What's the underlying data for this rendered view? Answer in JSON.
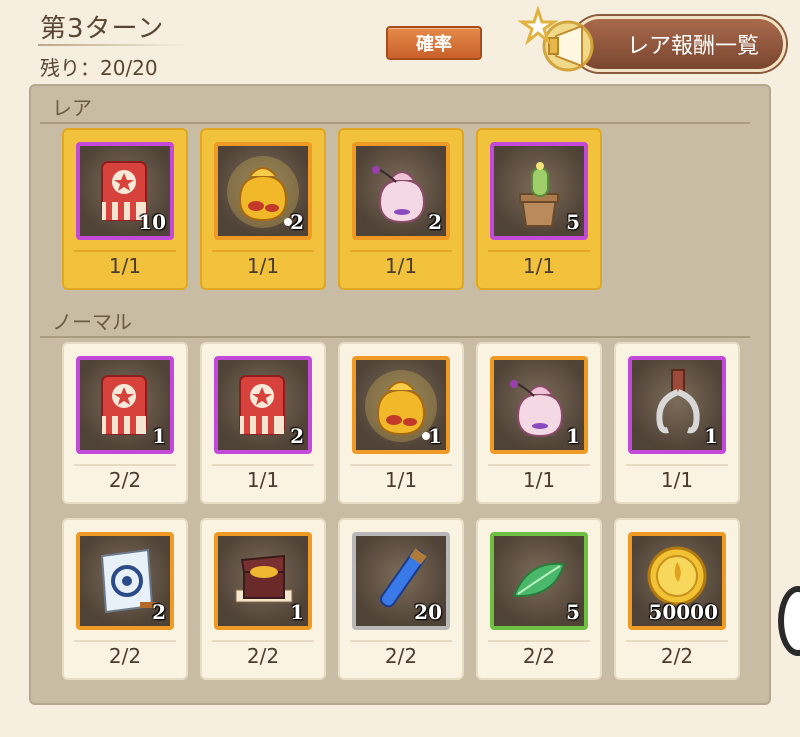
{
  "header": {
    "turn_title": "第3ターン",
    "remaining_label": "残り：20/20",
    "probability_button": "確率",
    "rare_rewards_button": "レア報酬一覧"
  },
  "sections": {
    "rare_label": "レア",
    "normal_label": "ノーマル"
  },
  "rare_items": [
    {
      "icon": "red-ticket-icon",
      "count": "10",
      "ratio": "1/1",
      "frame": "purple"
    },
    {
      "icon": "gold-pouch-icon",
      "count": "2",
      "ratio": "1/1",
      "frame": "orange"
    },
    {
      "icon": "pink-pouch-icon",
      "count": "2",
      "ratio": "1/1",
      "frame": "orange"
    },
    {
      "icon": "cactus-pot-icon",
      "count": "5",
      "ratio": "1/1",
      "frame": "purple"
    }
  ],
  "normal_row1": [
    {
      "icon": "red-ticket-icon",
      "count": "1",
      "ratio": "2/2",
      "frame": "purple"
    },
    {
      "icon": "red-ticket-icon",
      "count": "2",
      "ratio": "1/1",
      "frame": "purple"
    },
    {
      "icon": "gold-pouch-icon",
      "count": "1",
      "ratio": "1/1",
      "frame": "orange"
    },
    {
      "icon": "pink-pouch-icon",
      "count": "1",
      "ratio": "1/1",
      "frame": "orange"
    },
    {
      "icon": "claw-icon",
      "count": "1",
      "ratio": "1/1",
      "frame": "purple"
    }
  ],
  "normal_row2": [
    {
      "icon": "scroll-icon",
      "count": "2",
      "ratio": "2/2",
      "frame": "orange"
    },
    {
      "icon": "treasure-box-icon",
      "count": "1",
      "ratio": "2/2",
      "frame": "orange"
    },
    {
      "icon": "blue-vial-icon",
      "count": "20",
      "ratio": "2/2",
      "frame": "silver"
    },
    {
      "icon": "green-leaf-icon",
      "count": "5",
      "ratio": "2/2",
      "frame": "green"
    },
    {
      "icon": "gold-coin-icon",
      "count": "50000",
      "ratio": "2/2",
      "frame": "orange"
    }
  ]
}
